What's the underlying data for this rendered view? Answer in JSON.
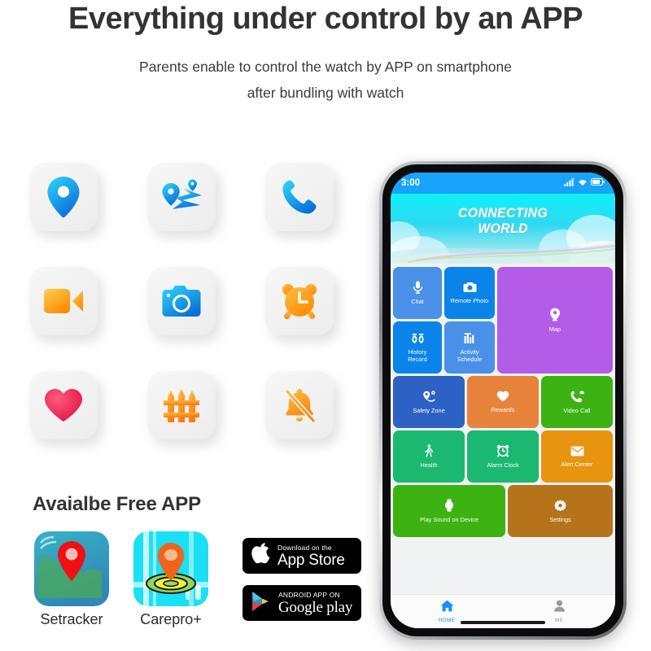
{
  "header": {
    "title": "Everything under control by an APP",
    "subtitle_line1": "Parents enable to control the watch by APP on smartphone",
    "subtitle_line2": "after bundling with watch"
  },
  "features": {
    "icons": [
      {
        "name": "location-pin-icon",
        "color": "#29c6f5"
      },
      {
        "name": "route-map-icon",
        "color": "#29c6f5"
      },
      {
        "name": "phone-call-icon",
        "color": "#29c6f5"
      },
      {
        "name": "video-camera-icon",
        "color": "#ffb13d"
      },
      {
        "name": "photo-camera-icon",
        "color": "#2ac8f5"
      },
      {
        "name": "alarm-clock-icon",
        "color": "#ffa52b"
      },
      {
        "name": "heart-icon",
        "color": "#f73a5e"
      },
      {
        "name": "fence-icon",
        "color": "#ffa52b"
      },
      {
        "name": "bell-off-icon",
        "color": "#ffa52b"
      }
    ]
  },
  "available_app": {
    "title": "Avaialbe Free APP",
    "apps": [
      {
        "label": "Setracker",
        "icon": "setracker-app-icon"
      },
      {
        "label": "Carepro+",
        "icon": "carepro-app-icon"
      }
    ],
    "badges": [
      {
        "small": "Download on the",
        "large": "App Store",
        "icon": "apple-logo-icon"
      },
      {
        "small": "ANDROID APP ON",
        "large": "Google play",
        "icon": "google-play-triangle-icon"
      }
    ]
  },
  "phone": {
    "status_bar": {
      "time": "3:00",
      "icons": [
        "signal-bars-icon",
        "wifi-icon",
        "battery-icon"
      ]
    },
    "hero": {
      "line1": "CONNECTING",
      "line2": "WORLD"
    },
    "tiles": [
      {
        "label": "Chat",
        "icon": "microphone-icon",
        "color": "#4a90e8"
      },
      {
        "label": "Remote Photo",
        "icon": "camera-icon",
        "color": "#0a84e8"
      },
      {
        "label": "Map",
        "icon": "map-pin-icon",
        "color": "#b35ce8"
      },
      {
        "label": "History\nRecord",
        "icon": "footprints-icon",
        "color": "#0a84e8"
      },
      {
        "label": "Activity\nSchedule",
        "icon": "bar-chart-icon",
        "color": "#4a90e8"
      },
      {
        "label": "Safety Zone",
        "icon": "safety-zone-icon",
        "color": "#2d62c4"
      },
      {
        "label": "Rewards",
        "icon": "heart-icon",
        "color": "#e8833c"
      },
      {
        "label": "Video Call",
        "icon": "video-call-icon",
        "color": "#3cb313"
      },
      {
        "label": "Health",
        "icon": "walking-icon",
        "color": "#1bb871"
      },
      {
        "label": "Alarm Clock",
        "icon": "alarm-icon",
        "color": "#1bb871"
      },
      {
        "label": "Alert Center",
        "icon": "envelope-icon",
        "color": "#e8940f"
      },
      {
        "label": "Play Sound on Device",
        "icon": "watch-icon",
        "color": "#3cb313"
      },
      {
        "label": "Settings",
        "icon": "gear-icon",
        "color": "#b5741c"
      }
    ],
    "nav": [
      {
        "label": "HOME",
        "icon": "home-icon",
        "active": true
      },
      {
        "label": "ME",
        "icon": "person-icon",
        "active": false
      }
    ]
  }
}
